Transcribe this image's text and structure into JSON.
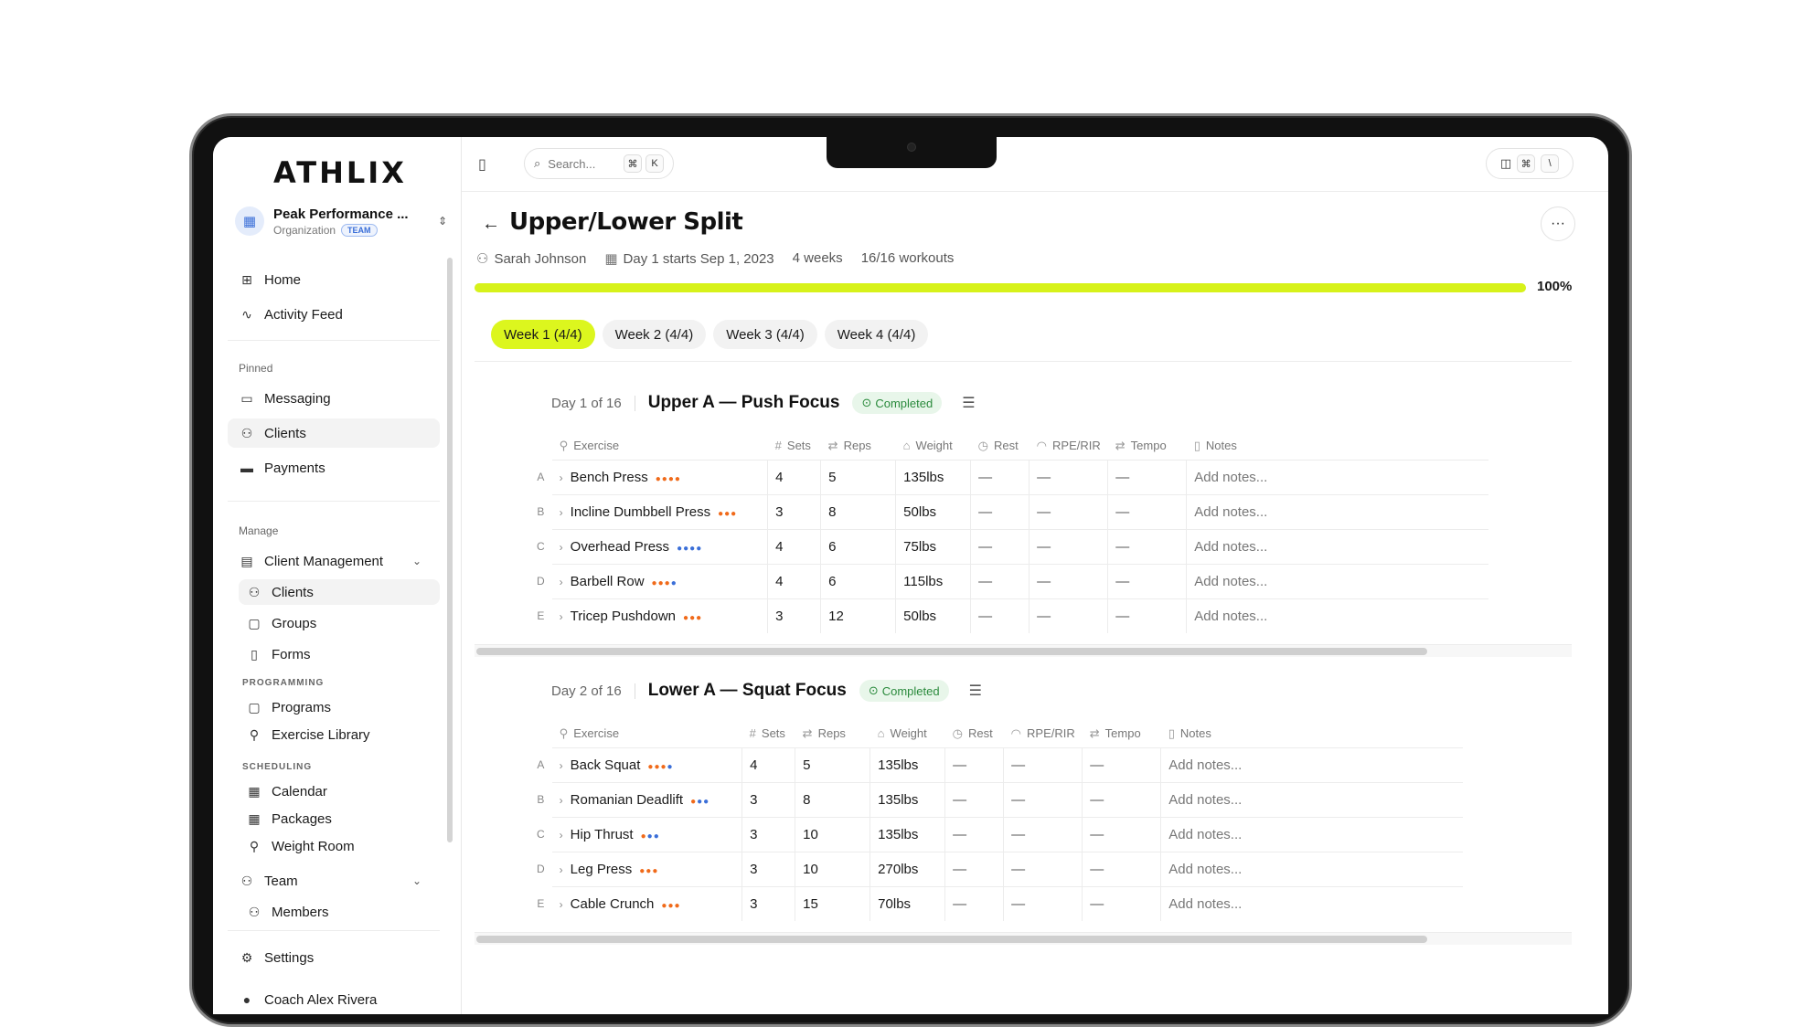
{
  "sidebar": {
    "logo": "ATHLIX",
    "org_name": "Peak Performance ...",
    "org_sub": "Organization",
    "org_badge": "TEAM",
    "home": "Home",
    "activity": "Activity Feed",
    "pinned_label": "Pinned",
    "messaging": "Messaging",
    "clients": "Clients",
    "payments": "Payments",
    "manage_label": "Manage",
    "client_mgmt": "Client Management",
    "cm_clients": "Clients",
    "cm_groups": "Groups",
    "cm_forms": "Forms",
    "programming_label": "PROGRAMMING",
    "programs": "Programs",
    "exercise_library": "Exercise Library",
    "scheduling_label": "SCHEDULING",
    "calendar": "Calendar",
    "packages": "Packages",
    "weight_room": "Weight Room",
    "team": "Team",
    "members": "Members",
    "settings": "Settings",
    "user": "Coach Alex Rivera"
  },
  "topbar": {
    "search_placeholder": "Search...",
    "search_kbd1": "⌘",
    "search_kbd2": "K",
    "right_kbd1": "⌘",
    "right_kbd2": "\\"
  },
  "program": {
    "title": "Upper/Lower Split",
    "client": "Sarah Johnson",
    "start": "Day 1 starts Sep 1, 2023",
    "duration": "4 weeks",
    "workouts": "16/16 workouts",
    "progress": 100,
    "progress_label": "100%"
  },
  "tabs": [
    "Week 1 (4/4)",
    "Week 2 (4/4)",
    "Week 3 (4/4)",
    "Week 4 (4/4)"
  ],
  "columns": {
    "exercise": "Exercise",
    "sets": "Sets",
    "reps": "Reps",
    "weight": "Weight",
    "rest": "Rest",
    "rpe": "RPE/RIR",
    "tempo": "Tempo",
    "notes": "Notes"
  },
  "days": [
    {
      "count": "Day 1 of 16",
      "title": "Upper A — Push Focus",
      "status": "Completed",
      "rows": [
        {
          "letter": "A",
          "name": "Bench Press",
          "sets": "4",
          "reps": "5",
          "weight": "135lbs",
          "rest": "—",
          "rpe": "—",
          "tempo": "—",
          "notes": "Add notes..."
        },
        {
          "letter": "B",
          "name": "Incline Dumbbell Press",
          "sets": "3",
          "reps": "8",
          "weight": "50lbs",
          "rest": "—",
          "rpe": "—",
          "tempo": "—",
          "notes": "Add notes..."
        },
        {
          "letter": "C",
          "name": "Overhead Press",
          "sets": "4",
          "reps": "6",
          "weight": "75lbs",
          "rest": "—",
          "rpe": "—",
          "tempo": "—",
          "notes": "Add notes..."
        },
        {
          "letter": "D",
          "name": "Barbell Row",
          "sets": "4",
          "reps": "6",
          "weight": "115lbs",
          "rest": "—",
          "rpe": "—",
          "tempo": "—",
          "notes": "Add notes..."
        },
        {
          "letter": "E",
          "name": "Tricep Pushdown",
          "sets": "3",
          "reps": "12",
          "weight": "50lbs",
          "rest": "—",
          "rpe": "—",
          "tempo": "—",
          "notes": "Add notes..."
        }
      ]
    },
    {
      "count": "Day 2 of 16",
      "title": "Lower A — Squat Focus",
      "status": "Completed",
      "rows": [
        {
          "letter": "A",
          "name": "Back Squat",
          "sets": "4",
          "reps": "5",
          "weight": "135lbs",
          "rest": "—",
          "rpe": "—",
          "tempo": "—",
          "notes": "Add notes..."
        },
        {
          "letter": "B",
          "name": "Romanian Deadlift",
          "sets": "3",
          "reps": "8",
          "weight": "135lbs",
          "rest": "—",
          "rpe": "—",
          "tempo": "—",
          "notes": "Add notes..."
        },
        {
          "letter": "C",
          "name": "Hip Thrust",
          "sets": "3",
          "reps": "10",
          "weight": "135lbs",
          "rest": "—",
          "rpe": "—",
          "tempo": "—",
          "notes": "Add notes..."
        },
        {
          "letter": "D",
          "name": "Leg Press",
          "sets": "3",
          "reps": "10",
          "weight": "270lbs",
          "rest": "—",
          "rpe": "—",
          "tempo": "—",
          "notes": "Add notes..."
        },
        {
          "letter": "E",
          "name": "Cable Crunch",
          "sets": "3",
          "reps": "15",
          "weight": "70lbs",
          "rest": "—",
          "rpe": "—",
          "tempo": "—",
          "notes": "Add notes..."
        }
      ]
    }
  ],
  "colors": {
    "accent": "#dcf61e",
    "progress": "#d7f21a",
    "status_green": "#2a8a3c",
    "dot_orange": "#f06a1a",
    "dot_blue": "#3b6fd8"
  }
}
